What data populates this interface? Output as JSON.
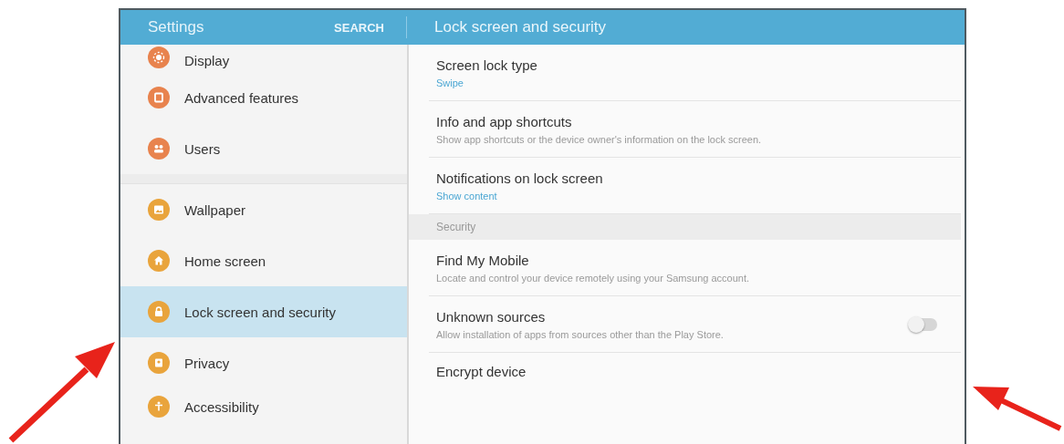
{
  "header": {
    "title": "Settings",
    "search": "SEARCH",
    "pane_title": "Lock screen and security"
  },
  "sidebar": {
    "items": [
      {
        "label": "Display",
        "selected": false,
        "color": "#e8834e"
      },
      {
        "label": "Advanced features",
        "selected": false,
        "color": "#e8834e"
      },
      {
        "label": "Users",
        "selected": false,
        "color": "#e8834e"
      },
      {
        "label": "Wallpaper",
        "selected": false,
        "color": "#e9a43c"
      },
      {
        "label": "Home screen",
        "selected": false,
        "color": "#e9a43c"
      },
      {
        "label": "Lock screen and security",
        "selected": true,
        "color": "#e9a43c"
      },
      {
        "label": "Privacy",
        "selected": false,
        "color": "#e9a43c"
      },
      {
        "label": "Accessibility",
        "selected": false,
        "color": "#e9a43c"
      }
    ]
  },
  "content": {
    "rows": [
      {
        "kind": "value",
        "title": "Screen lock type",
        "summary": "Swipe"
      },
      {
        "kind": "description",
        "title": "Info and app shortcuts",
        "summary": "Show app shortcuts or the device owner's information on the lock screen."
      },
      {
        "kind": "value",
        "title": "Notifications on lock screen",
        "summary": "Show content"
      },
      {
        "kind": "section",
        "title": "Security"
      },
      {
        "kind": "description",
        "title": "Find My Mobile",
        "summary": "Locate and control your device remotely using your Samsung account."
      },
      {
        "kind": "switch",
        "title": "Unknown sources",
        "summary": "Allow installation of apps from sources other than the Play Store.",
        "on": false
      },
      {
        "kind": "plain",
        "title": "Encrypt device"
      }
    ]
  }
}
